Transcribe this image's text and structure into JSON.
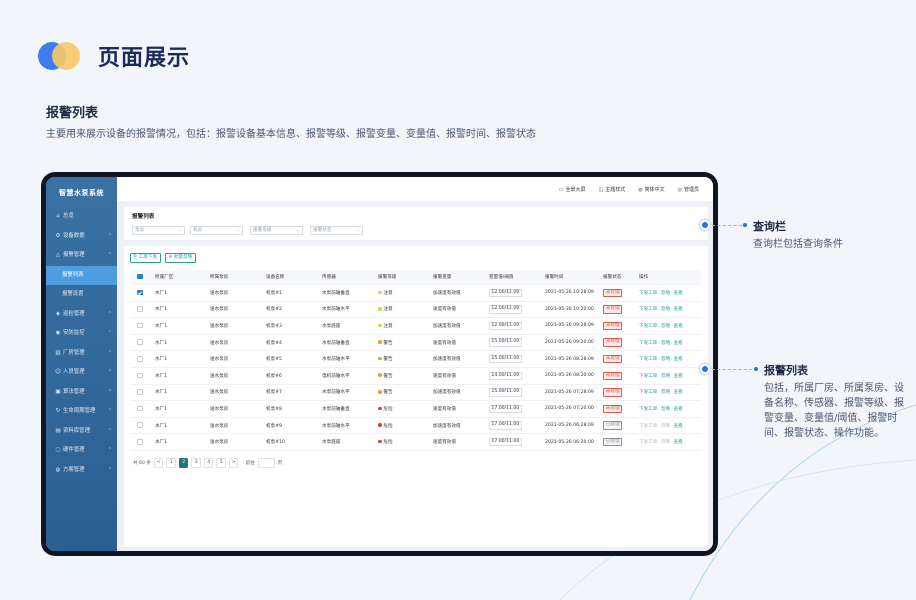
{
  "header": {
    "title": "页面展示",
    "section_title": "报警列表",
    "section_desc": "主要用来展示设备的报警情况，包括：报警设备基本信息、报警等级、报警变量、变量值、报警时间、报警状态"
  },
  "colors": {
    "accent": "#2d9d97",
    "primary": "#2f6fe0",
    "sidebar": "#3a72a4",
    "active_page": "#1f7a74"
  },
  "app": {
    "name": "智慧水泵系统",
    "topbar": [
      {
        "icon": "monitor-icon",
        "label": "全景大屏"
      },
      {
        "icon": "shirt-icon",
        "label": "主题样式"
      },
      {
        "icon": "globe-icon",
        "label": "简体中文"
      },
      {
        "icon": "user-icon",
        "label": "管理员"
      }
    ],
    "sidebar": [
      {
        "label": "总览",
        "icon": "home-icon",
        "arrow": false
      },
      {
        "label": "设备数据",
        "icon": "gear-icon",
        "arrow": true
      },
      {
        "label": "报警管理",
        "icon": "alert-icon",
        "arrow": true
      },
      {
        "label": "报警列表",
        "sub": true,
        "active": true
      },
      {
        "label": "报警设置",
        "sub": true
      },
      {
        "label": "巡检管理",
        "icon": "inspect-icon",
        "arrow": true
      },
      {
        "label": "安防监控",
        "icon": "camera-icon",
        "arrow": true
      },
      {
        "label": "厂房管理",
        "icon": "factory-icon",
        "arrow": true
      },
      {
        "label": "人员管理",
        "icon": "person-icon",
        "arrow": true
      },
      {
        "label": "算法管理",
        "icon": "algorithm-icon",
        "arrow": true
      },
      {
        "label": "生命周期管理",
        "icon": "cycle-icon",
        "arrow": true
      },
      {
        "label": "资料库管理",
        "icon": "database-icon",
        "arrow": true
      },
      {
        "label": "硬件管理",
        "icon": "hardware-icon",
        "arrow": true
      },
      {
        "label": "方案管理",
        "icon": "location-icon",
        "arrow": true
      }
    ],
    "query": {
      "title": "报警列表",
      "fields": [
        "泵房",
        "机房",
        "报警等级",
        "报警状态"
      ]
    },
    "buttons": {
      "dispatch": "工单下发",
      "ignore": "批量忽略"
    },
    "table": {
      "headers": [
        "所属厂区",
        "所属泵房",
        "设备名称",
        "传感器",
        "报警等级",
        "报警变量",
        "变量值/阈值",
        "报警时间",
        "报警状态",
        "操作"
      ],
      "rows": [
        {
          "checked": true,
          "area": "水厂1",
          "room": "送水泵房",
          "device": "机泵#1",
          "sensor": "水泵前轴垂直",
          "level": "注意",
          "var": "加速度有效值",
          "value": "12.00/11.00",
          "time": "2021-05-26 10:28:09",
          "status": "未处理"
        },
        {
          "checked": false,
          "area": "水厂1",
          "room": "送水泵房",
          "device": "机泵#2",
          "sensor": "水泵前轴水平",
          "level": "注意",
          "var": "速度有效值",
          "value": "12.00/11.00",
          "time": "2021-05-26 10:20:00",
          "status": "未处理"
        },
        {
          "checked": false,
          "area": "水厂1",
          "room": "送水泵房",
          "device": "机泵#3",
          "sensor": "水泵底座",
          "level": "注意",
          "var": "加速度有效值",
          "value": "12.00/11.00",
          "time": "2021-05-26 09:28:09",
          "status": "未处理"
        },
        {
          "checked": false,
          "area": "水厂1",
          "room": "送水泵房",
          "device": "机泵#4",
          "sensor": "水泵前轴垂直",
          "level": "警告",
          "var": "速度有效值",
          "value": "15.00/11.00",
          "time": "2021-05-26 09:20:00",
          "status": "未处理"
        },
        {
          "checked": false,
          "area": "水厂1",
          "room": "送水泵房",
          "device": "机泵#5",
          "sensor": "水泵前轴水平",
          "level": "警告",
          "var": "加速度有效值",
          "value": "15.00/11.00",
          "time": "2021-05-26 08:28:09",
          "status": "未处理"
        },
        {
          "checked": false,
          "area": "水厂1",
          "room": "送水泵房",
          "device": "机泵#6",
          "sensor": "电机前轴水平",
          "level": "警告",
          "var": "速度有效值",
          "value": "14.00/11.00",
          "time": "2021-05-26 08:20:00",
          "status": "未处理"
        },
        {
          "checked": false,
          "area": "水厂1",
          "room": "送水泵房",
          "device": "机泵#7",
          "sensor": "水泵前轴水平",
          "level": "警告",
          "var": "加速度有效值",
          "value": "15.00/11.00",
          "time": "2021-05-26 07:28:09",
          "status": "未处理"
        },
        {
          "checked": false,
          "area": "水厂1",
          "room": "送水泵房",
          "device": "机泵#8",
          "sensor": "水泵前轴垂直",
          "level": "危险",
          "var": "速度有效值",
          "value": "17.00/11.00",
          "time": "2021-05-26 07:20:00",
          "status": "未处理"
        },
        {
          "checked": false,
          "area": "水厂1",
          "room": "送水泵房",
          "device": "机泵#9",
          "sensor": "水泵前轴水平",
          "level": "危险",
          "var": "加速度有效值",
          "value": "17.00/11.00",
          "time": "2021-05-26 06:28:09",
          "status": "已处理"
        },
        {
          "checked": false,
          "area": "水厂1",
          "room": "送水泵房",
          "device": "机泵#10",
          "sensor": "水泵底座",
          "level": "危险",
          "var": "速度有效值",
          "value": "17.00/11.00",
          "time": "2021-05-26 06:20:00",
          "status": "已处理"
        }
      ],
      "ops": [
        "下发工单",
        "忽略",
        "查看"
      ]
    },
    "level_colors": {
      "注意": "#f4c531",
      "警告": "#f29a38",
      "危险": "#d9413b"
    },
    "status_colors": {
      "未处理": "#e8554e",
      "已处理": "#8a9099"
    },
    "pagination": {
      "total": "共 60 条",
      "prev": "<",
      "next": ">",
      "pages": [
        "1",
        "2",
        "3",
        "4",
        "5"
      ],
      "current": "2",
      "goto": "前往",
      "unit": "页"
    }
  },
  "annotations": {
    "query_title": "查询栏",
    "query_desc": "查询栏包括查询条件",
    "list_title": "报警列表",
    "list_desc": "包括，所属厂房、所属泵房、设备名称、传感器、报警等级、报警变量、变量值/阈值、报警时间、报警状态、操作功能。"
  }
}
